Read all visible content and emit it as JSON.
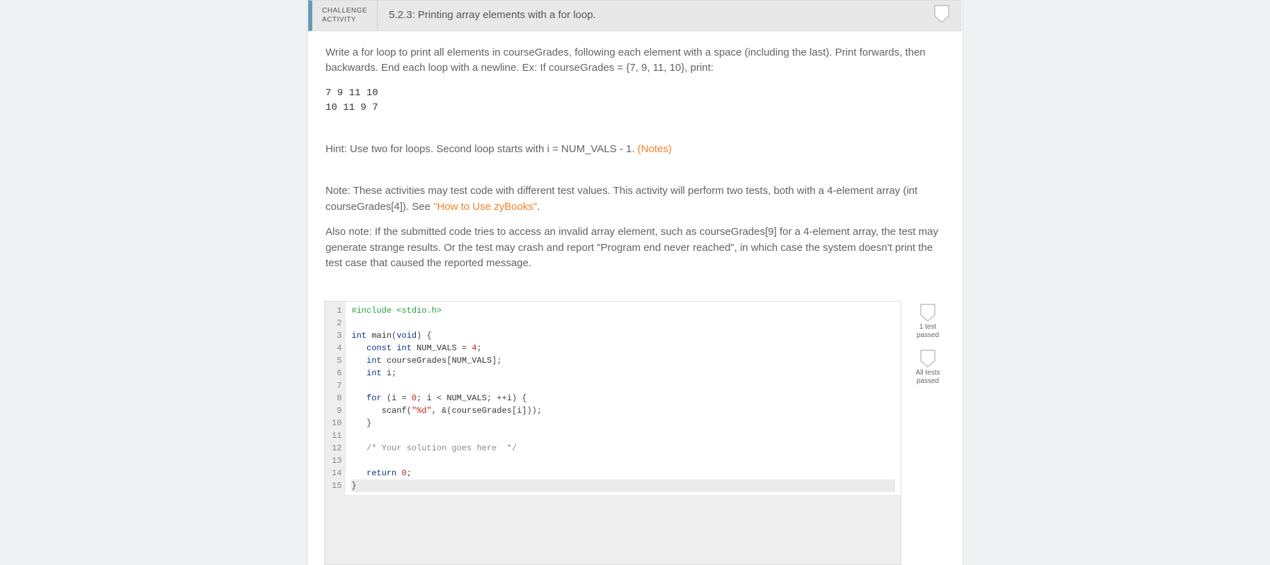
{
  "header": {
    "label_line1": "CHALLENGE",
    "label_line2": "ACTIVITY",
    "title": "5.2.3: Printing array elements with a for loop."
  },
  "instructions": {
    "intro": "Write a for loop to print all elements in courseGrades, following each element with a space (including the last). Print forwards, then backwards. End each loop with a newline. Ex: If courseGrades = {7, 9, 11, 10}, print:",
    "sample_line1": "7 9 11 10",
    "sample_line2": "10 11 9 7",
    "hint_text": "Hint: Use two for loops. Second loop starts with i = NUM_VALS - 1. ",
    "hint_link": "(Notes)",
    "note1_a": "Note: These activities may test code with different test values. This activity will perform two tests, both with a 4-element array (int courseGrades[4]). See ",
    "note1_link": "\"How to Use zyBooks\"",
    "note1_b": ".",
    "note2": "Also note: If the submitted code tries to access an invalid array element, such as courseGrades[9] for a 4-element array, the test may generate strange results. Or the test may crash and report \"Program end never reached\", in which case the system doesn't print the test case that caused the reported message."
  },
  "code": {
    "lines": [
      {
        "n": "1",
        "seg": [
          [
            "pre",
            "#include <stdio.h>"
          ]
        ]
      },
      {
        "n": "2",
        "seg": [
          [
            "id",
            ""
          ]
        ]
      },
      {
        "n": "3",
        "seg": [
          [
            "ty",
            "int"
          ],
          [
            "id",
            " main"
          ],
          [
            "pn",
            "("
          ],
          [
            "ty",
            "void"
          ],
          [
            "pn",
            ") {"
          ]
        ]
      },
      {
        "n": "4",
        "seg": [
          [
            "id",
            "   "
          ],
          [
            "kw",
            "const"
          ],
          [
            "id",
            " "
          ],
          [
            "ty",
            "int"
          ],
          [
            "id",
            " NUM_VALS "
          ],
          [
            "pn",
            "= "
          ],
          [
            "num",
            "4"
          ],
          [
            "pn",
            ";"
          ]
        ]
      },
      {
        "n": "5",
        "seg": [
          [
            "id",
            "   "
          ],
          [
            "ty",
            "int"
          ],
          [
            "id",
            " courseGrades"
          ],
          [
            "pn",
            "["
          ],
          [
            "id",
            "NUM_VALS"
          ],
          [
            "pn",
            "];"
          ]
        ]
      },
      {
        "n": "6",
        "seg": [
          [
            "id",
            "   "
          ],
          [
            "ty",
            "int"
          ],
          [
            "id",
            " i"
          ],
          [
            "pn",
            ";"
          ]
        ]
      },
      {
        "n": "7",
        "seg": [
          [
            "id",
            ""
          ]
        ]
      },
      {
        "n": "8",
        "seg": [
          [
            "id",
            "   "
          ],
          [
            "kw",
            "for"
          ],
          [
            "id",
            " "
          ],
          [
            "pn",
            "("
          ],
          [
            "id",
            "i "
          ],
          [
            "pn",
            "= "
          ],
          [
            "num",
            "0"
          ],
          [
            "pn",
            "; "
          ],
          [
            "id",
            "i "
          ],
          [
            "pn",
            "< "
          ],
          [
            "id",
            "NUM_VALS"
          ],
          [
            "pn",
            "; ++"
          ],
          [
            "id",
            "i"
          ],
          [
            "pn",
            ") {"
          ]
        ]
      },
      {
        "n": "9",
        "seg": [
          [
            "id",
            "      scanf"
          ],
          [
            "pn",
            "("
          ],
          [
            "str",
            "\"%d\""
          ],
          [
            "pn",
            ", &("
          ],
          [
            "id",
            "courseGrades"
          ],
          [
            "pn",
            "["
          ],
          [
            "id",
            "i"
          ],
          [
            "pn",
            "]));"
          ]
        ]
      },
      {
        "n": "10",
        "seg": [
          [
            "id",
            "   "
          ],
          [
            "pn",
            "}"
          ]
        ]
      },
      {
        "n": "11",
        "seg": [
          [
            "id",
            ""
          ]
        ]
      },
      {
        "n": "12",
        "seg": [
          [
            "id",
            "   "
          ],
          [
            "cm",
            "/* Your solution goes here  */"
          ]
        ]
      },
      {
        "n": "13",
        "seg": [
          [
            "id",
            ""
          ]
        ]
      },
      {
        "n": "14",
        "seg": [
          [
            "id",
            "   "
          ],
          [
            "kw",
            "return"
          ],
          [
            "id",
            " "
          ],
          [
            "num",
            "0"
          ],
          [
            "pn",
            ";"
          ]
        ]
      },
      {
        "n": "15",
        "seg": [
          [
            "pn",
            "}"
          ]
        ],
        "active": true
      }
    ]
  },
  "side": {
    "badge1": "1 test\npassed",
    "badge2": "All tests\npassed"
  }
}
